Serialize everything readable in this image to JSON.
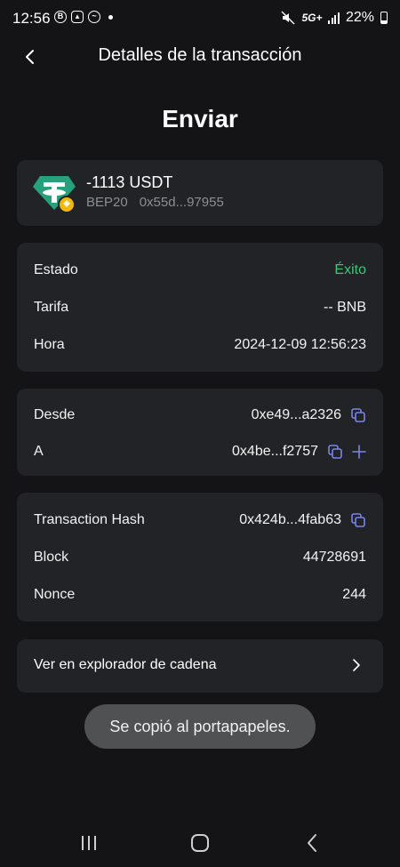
{
  "status_bar": {
    "time": "12:56",
    "network": "5G+",
    "battery": "22%",
    "icons": [
      "b-icon",
      "image-icon",
      "messenger-icon",
      "mute-icon",
      "signal-icon",
      "battery-icon"
    ]
  },
  "header": {
    "title": "Detalles de la transacción"
  },
  "page_title": "Enviar",
  "asset": {
    "amount": "-1113 USDT",
    "network": "BEP20",
    "address": "0x55d...97955",
    "icon": "tether-icon"
  },
  "status_card": {
    "rows": [
      {
        "label": "Estado",
        "value": "Éxito"
      },
      {
        "label": "Tarifa",
        "value": "-- BNB"
      },
      {
        "label": "Hora",
        "value": "2024-12-09 12:56:23"
      }
    ]
  },
  "address_card": {
    "rows": [
      {
        "label": "Desde",
        "value": "0xe49...a2326"
      },
      {
        "label": "A",
        "value": "0x4be...f2757"
      }
    ]
  },
  "hash_card": {
    "rows": [
      {
        "label": "Transaction Hash",
        "value": "0x424b...4fab63"
      },
      {
        "label": "Block",
        "value": "44728691"
      },
      {
        "label": "Nonce",
        "value": "244"
      }
    ]
  },
  "explorer": {
    "label": "Ver en explorador de cadena"
  },
  "toast": {
    "text": "Se copió al portapapeles."
  },
  "colors": {
    "background": "#141416",
    "card": "#222326",
    "success": "#3fc57a",
    "accent_icon": "#7b84e8",
    "toast": "#505152"
  }
}
